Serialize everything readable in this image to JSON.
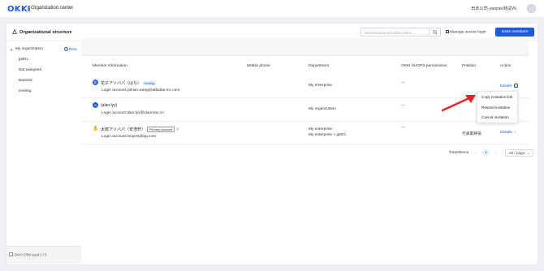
{
  "topbar": {
    "logo": "OKKI",
    "app_title": "Organization center",
    "company": "日本公司-yaoyao测试V6"
  },
  "structure": {
    "title": "Organizational structure",
    "search_placeholder": "Name/nickname/mobile phone…",
    "secure_login": "Manage secure login",
    "invite_button": "Invite members"
  },
  "sidebar": {
    "root": "My organization",
    "new_label": "New",
    "items": [
      "jp001",
      "Not assigned",
      "Banned",
      "Inviting"
    ],
    "crm_used": "OKKI CRM used 2 / 5"
  },
  "table": {
    "headers": {
      "member": "Member information",
      "phone": "Mobile phone",
      "department": "Department",
      "shops": "OKKI SHOPS permissions",
      "position": "Position",
      "action": "Action"
    },
    "rows": [
      {
        "name": "花子アソバパ（はな）",
        "status": "Inviting",
        "login": "Login account:yishan.wang@alibaba-inc.com",
        "department": "My enterprise",
        "shops": "---",
        "position": "",
        "action": "Details"
      },
      {
        "name": "(alan.lyy)",
        "login": "Login account:alan.lyy@xiaoman.cn",
        "department": "My organization",
        "shops": "---",
        "position": "",
        "action": ""
      },
      {
        "name": "太郎アソバパ（安浩轩）",
        "badge": "Primary account",
        "login": "Login account:zeayes@qq.com",
        "department": "My enterprise",
        "department2": "My enterprise > jp001",
        "shops": "---",
        "position": "代表取締役",
        "action": "Details"
      }
    ]
  },
  "menu": {
    "items": [
      "Copy invitation link",
      "Resend invitation",
      "Cancel invitation"
    ]
  },
  "pagination": {
    "total": "Total3items",
    "current": "1",
    "page_size": "20 / page"
  },
  "colors": {
    "accent": "#1e5bd8",
    "arrow": "#e0252b"
  }
}
